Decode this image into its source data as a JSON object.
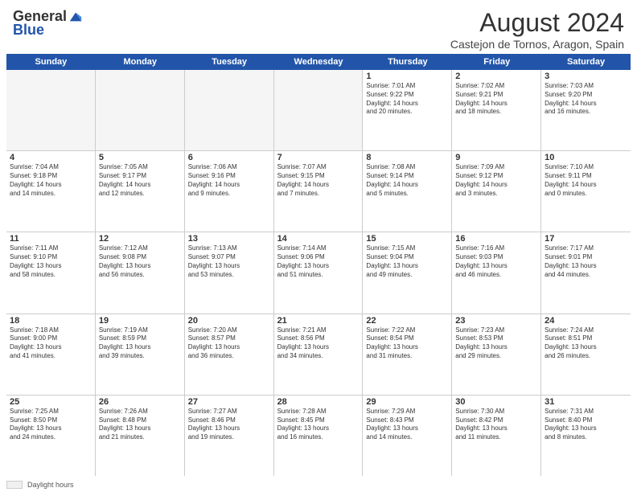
{
  "header": {
    "logo_general": "General",
    "logo_blue": "Blue",
    "month_title": "August 2024",
    "subtitle": "Castejon de Tornos, Aragon, Spain"
  },
  "days_of_week": [
    "Sunday",
    "Monday",
    "Tuesday",
    "Wednesday",
    "Thursday",
    "Friday",
    "Saturday"
  ],
  "weeks": [
    [
      {
        "day": "",
        "info": "",
        "empty": true
      },
      {
        "day": "",
        "info": "",
        "empty": true
      },
      {
        "day": "",
        "info": "",
        "empty": true
      },
      {
        "day": "",
        "info": "",
        "empty": true
      },
      {
        "day": "1",
        "info": "Sunrise: 7:01 AM\nSunset: 9:22 PM\nDaylight: 14 hours\nand 20 minutes.",
        "empty": false
      },
      {
        "day": "2",
        "info": "Sunrise: 7:02 AM\nSunset: 9:21 PM\nDaylight: 14 hours\nand 18 minutes.",
        "empty": false
      },
      {
        "day": "3",
        "info": "Sunrise: 7:03 AM\nSunset: 9:20 PM\nDaylight: 14 hours\nand 16 minutes.",
        "empty": false
      }
    ],
    [
      {
        "day": "4",
        "info": "Sunrise: 7:04 AM\nSunset: 9:18 PM\nDaylight: 14 hours\nand 14 minutes.",
        "empty": false
      },
      {
        "day": "5",
        "info": "Sunrise: 7:05 AM\nSunset: 9:17 PM\nDaylight: 14 hours\nand 12 minutes.",
        "empty": false
      },
      {
        "day": "6",
        "info": "Sunrise: 7:06 AM\nSunset: 9:16 PM\nDaylight: 14 hours\nand 9 minutes.",
        "empty": false
      },
      {
        "day": "7",
        "info": "Sunrise: 7:07 AM\nSunset: 9:15 PM\nDaylight: 14 hours\nand 7 minutes.",
        "empty": false
      },
      {
        "day": "8",
        "info": "Sunrise: 7:08 AM\nSunset: 9:14 PM\nDaylight: 14 hours\nand 5 minutes.",
        "empty": false
      },
      {
        "day": "9",
        "info": "Sunrise: 7:09 AM\nSunset: 9:12 PM\nDaylight: 14 hours\nand 3 minutes.",
        "empty": false
      },
      {
        "day": "10",
        "info": "Sunrise: 7:10 AM\nSunset: 9:11 PM\nDaylight: 14 hours\nand 0 minutes.",
        "empty": false
      }
    ],
    [
      {
        "day": "11",
        "info": "Sunrise: 7:11 AM\nSunset: 9:10 PM\nDaylight: 13 hours\nand 58 minutes.",
        "empty": false
      },
      {
        "day": "12",
        "info": "Sunrise: 7:12 AM\nSunset: 9:08 PM\nDaylight: 13 hours\nand 56 minutes.",
        "empty": false
      },
      {
        "day": "13",
        "info": "Sunrise: 7:13 AM\nSunset: 9:07 PM\nDaylight: 13 hours\nand 53 minutes.",
        "empty": false
      },
      {
        "day": "14",
        "info": "Sunrise: 7:14 AM\nSunset: 9:06 PM\nDaylight: 13 hours\nand 51 minutes.",
        "empty": false
      },
      {
        "day": "15",
        "info": "Sunrise: 7:15 AM\nSunset: 9:04 PM\nDaylight: 13 hours\nand 49 minutes.",
        "empty": false
      },
      {
        "day": "16",
        "info": "Sunrise: 7:16 AM\nSunset: 9:03 PM\nDaylight: 13 hours\nand 46 minutes.",
        "empty": false
      },
      {
        "day": "17",
        "info": "Sunrise: 7:17 AM\nSunset: 9:01 PM\nDaylight: 13 hours\nand 44 minutes.",
        "empty": false
      }
    ],
    [
      {
        "day": "18",
        "info": "Sunrise: 7:18 AM\nSunset: 9:00 PM\nDaylight: 13 hours\nand 41 minutes.",
        "empty": false
      },
      {
        "day": "19",
        "info": "Sunrise: 7:19 AM\nSunset: 8:59 PM\nDaylight: 13 hours\nand 39 minutes.",
        "empty": false
      },
      {
        "day": "20",
        "info": "Sunrise: 7:20 AM\nSunset: 8:57 PM\nDaylight: 13 hours\nand 36 minutes.",
        "empty": false
      },
      {
        "day": "21",
        "info": "Sunrise: 7:21 AM\nSunset: 8:56 PM\nDaylight: 13 hours\nand 34 minutes.",
        "empty": false
      },
      {
        "day": "22",
        "info": "Sunrise: 7:22 AM\nSunset: 8:54 PM\nDaylight: 13 hours\nand 31 minutes.",
        "empty": false
      },
      {
        "day": "23",
        "info": "Sunrise: 7:23 AM\nSunset: 8:53 PM\nDaylight: 13 hours\nand 29 minutes.",
        "empty": false
      },
      {
        "day": "24",
        "info": "Sunrise: 7:24 AM\nSunset: 8:51 PM\nDaylight: 13 hours\nand 26 minutes.",
        "empty": false
      }
    ],
    [
      {
        "day": "25",
        "info": "Sunrise: 7:25 AM\nSunset: 8:50 PM\nDaylight: 13 hours\nand 24 minutes.",
        "empty": false
      },
      {
        "day": "26",
        "info": "Sunrise: 7:26 AM\nSunset: 8:48 PM\nDaylight: 13 hours\nand 21 minutes.",
        "empty": false
      },
      {
        "day": "27",
        "info": "Sunrise: 7:27 AM\nSunset: 8:46 PM\nDaylight: 13 hours\nand 19 minutes.",
        "empty": false
      },
      {
        "day": "28",
        "info": "Sunrise: 7:28 AM\nSunset: 8:45 PM\nDaylight: 13 hours\nand 16 minutes.",
        "empty": false
      },
      {
        "day": "29",
        "info": "Sunrise: 7:29 AM\nSunset: 8:43 PM\nDaylight: 13 hours\nand 14 minutes.",
        "empty": false
      },
      {
        "day": "30",
        "info": "Sunrise: 7:30 AM\nSunset: 8:42 PM\nDaylight: 13 hours\nand 11 minutes.",
        "empty": false
      },
      {
        "day": "31",
        "info": "Sunrise: 7:31 AM\nSunset: 8:40 PM\nDaylight: 13 hours\nand 8 minutes.",
        "empty": false
      }
    ]
  ],
  "footer": {
    "swatch_label": "Daylight hours"
  }
}
